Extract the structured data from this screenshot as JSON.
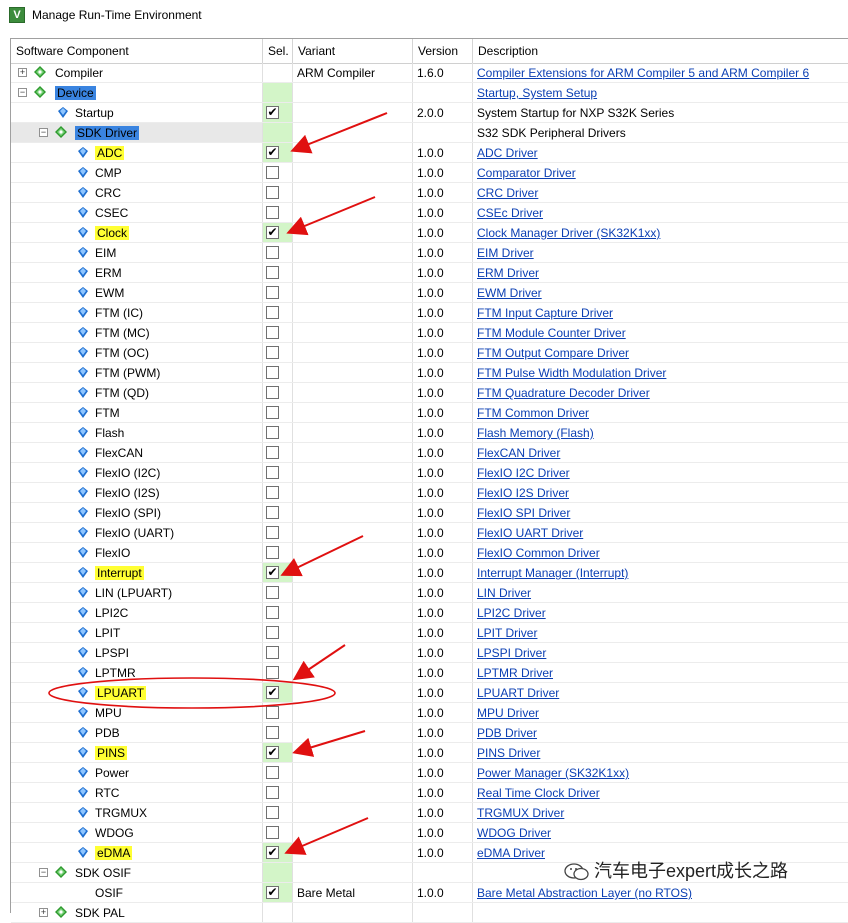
{
  "window": {
    "title": "Manage Run-Time Environment"
  },
  "columns": {
    "component": "Software Component",
    "sel": "Sel.",
    "variant": "Variant",
    "version": "Version",
    "description": "Description"
  },
  "rows": [
    {
      "label": "Compiler",
      "level": 0,
      "expander": "+",
      "icon": "green-gem",
      "selected": false,
      "checkbox": false,
      "green": false,
      "variant": "ARM Compiler",
      "version": "1.6.0",
      "desc": "Compiler Extensions for ARM Compiler 5 and ARM Compiler 6",
      "link": true,
      "hl": ""
    },
    {
      "label": "Device",
      "level": 0,
      "expander": "−",
      "icon": "green-gem",
      "selected": false,
      "checkbox": false,
      "green": true,
      "variant": "",
      "version": "",
      "desc": "Startup, System Setup",
      "link": true,
      "hl": "blue"
    },
    {
      "label": "Startup",
      "level": 1,
      "expander": "",
      "icon": "blue-gem",
      "selected": true,
      "checkbox": true,
      "green": true,
      "variant": "",
      "version": "2.0.0",
      "desc": "System Startup for NXP S32K Series",
      "link": false,
      "hl": ""
    },
    {
      "label": "SDK Driver",
      "level": 1,
      "expander": "−",
      "icon": "green-gem",
      "selected": false,
      "checkbox": false,
      "green": true,
      "variant": "",
      "version": "",
      "desc": "S32 SDK Peripheral Drivers",
      "link": false,
      "hl": "blue",
      "rowsel": true
    },
    {
      "label": "ADC",
      "level": 2,
      "expander": "",
      "icon": "blue-gem",
      "selected": true,
      "checkbox": true,
      "green": true,
      "variant": "",
      "version": "1.0.0",
      "desc": "ADC Driver",
      "link": true,
      "hl": "yellow"
    },
    {
      "label": "CMP",
      "level": 2,
      "expander": "",
      "icon": "blue-gem",
      "selected": false,
      "checkbox": true,
      "green": false,
      "variant": "",
      "version": "1.0.0",
      "desc": "Comparator Driver",
      "link": true,
      "hl": ""
    },
    {
      "label": "CRC",
      "level": 2,
      "expander": "",
      "icon": "blue-gem",
      "selected": false,
      "checkbox": true,
      "green": false,
      "variant": "",
      "version": "1.0.0",
      "desc": "CRC Driver",
      "link": true,
      "hl": ""
    },
    {
      "label": "CSEC",
      "level": 2,
      "expander": "",
      "icon": "blue-gem",
      "selected": false,
      "checkbox": true,
      "green": false,
      "variant": "",
      "version": "1.0.0",
      "desc": "CSEc Driver",
      "link": true,
      "hl": ""
    },
    {
      "label": "Clock",
      "level": 2,
      "expander": "",
      "icon": "blue-gem",
      "selected": true,
      "checkbox": true,
      "green": true,
      "variant": "",
      "version": "1.0.0",
      "desc": "Clock Manager Driver (SK32K1xx)",
      "link": true,
      "hl": "yellow"
    },
    {
      "label": "EIM",
      "level": 2,
      "expander": "",
      "icon": "blue-gem",
      "selected": false,
      "checkbox": true,
      "green": false,
      "variant": "",
      "version": "1.0.0",
      "desc": "EIM Driver",
      "link": true,
      "hl": ""
    },
    {
      "label": "ERM",
      "level": 2,
      "expander": "",
      "icon": "blue-gem",
      "selected": false,
      "checkbox": true,
      "green": false,
      "variant": "",
      "version": "1.0.0",
      "desc": "ERM Driver",
      "link": true,
      "hl": ""
    },
    {
      "label": "EWM",
      "level": 2,
      "expander": "",
      "icon": "blue-gem",
      "selected": false,
      "checkbox": true,
      "green": false,
      "variant": "",
      "version": "1.0.0",
      "desc": "EWM Driver",
      "link": true,
      "hl": ""
    },
    {
      "label": "FTM (IC)",
      "level": 2,
      "expander": "",
      "icon": "blue-gem",
      "selected": false,
      "checkbox": true,
      "green": false,
      "variant": "",
      "version": "1.0.0",
      "desc": "FTM Input Capture Driver",
      "link": true,
      "hl": ""
    },
    {
      "label": "FTM (MC)",
      "level": 2,
      "expander": "",
      "icon": "blue-gem",
      "selected": false,
      "checkbox": true,
      "green": false,
      "variant": "",
      "version": "1.0.0",
      "desc": "FTM Module Counter Driver",
      "link": true,
      "hl": ""
    },
    {
      "label": "FTM (OC)",
      "level": 2,
      "expander": "",
      "icon": "blue-gem",
      "selected": false,
      "checkbox": true,
      "green": false,
      "variant": "",
      "version": "1.0.0",
      "desc": "FTM Output Compare Driver",
      "link": true,
      "hl": ""
    },
    {
      "label": "FTM (PWM)",
      "level": 2,
      "expander": "",
      "icon": "blue-gem",
      "selected": false,
      "checkbox": true,
      "green": false,
      "variant": "",
      "version": "1.0.0",
      "desc": "FTM Pulse Width Modulation Driver",
      "link": true,
      "hl": ""
    },
    {
      "label": "FTM (QD)",
      "level": 2,
      "expander": "",
      "icon": "blue-gem",
      "selected": false,
      "checkbox": true,
      "green": false,
      "variant": "",
      "version": "1.0.0",
      "desc": "FTM Quadrature Decoder Driver",
      "link": true,
      "hl": ""
    },
    {
      "label": "FTM",
      "level": 2,
      "expander": "",
      "icon": "blue-gem",
      "selected": false,
      "checkbox": true,
      "green": false,
      "variant": "",
      "version": "1.0.0",
      "desc": "FTM Common Driver",
      "link": true,
      "hl": ""
    },
    {
      "label": "Flash",
      "level": 2,
      "expander": "",
      "icon": "blue-gem",
      "selected": false,
      "checkbox": true,
      "green": false,
      "variant": "",
      "version": "1.0.0",
      "desc": "Flash Memory (Flash)",
      "link": true,
      "hl": ""
    },
    {
      "label": "FlexCAN",
      "level": 2,
      "expander": "",
      "icon": "blue-gem",
      "selected": false,
      "checkbox": true,
      "green": false,
      "variant": "",
      "version": "1.0.0",
      "desc": "FlexCAN Driver",
      "link": true,
      "hl": ""
    },
    {
      "label": "FlexIO (I2C)",
      "level": 2,
      "expander": "",
      "icon": "blue-gem",
      "selected": false,
      "checkbox": true,
      "green": false,
      "variant": "",
      "version": "1.0.0",
      "desc": "FlexIO I2C Driver",
      "link": true,
      "hl": ""
    },
    {
      "label": "FlexIO (I2S)",
      "level": 2,
      "expander": "",
      "icon": "blue-gem",
      "selected": false,
      "checkbox": true,
      "green": false,
      "variant": "",
      "version": "1.0.0",
      "desc": "FlexIO I2S Driver",
      "link": true,
      "hl": ""
    },
    {
      "label": "FlexIO (SPI)",
      "level": 2,
      "expander": "",
      "icon": "blue-gem",
      "selected": false,
      "checkbox": true,
      "green": false,
      "variant": "",
      "version": "1.0.0",
      "desc": "FlexIO SPI Driver",
      "link": true,
      "hl": ""
    },
    {
      "label": "FlexIO (UART)",
      "level": 2,
      "expander": "",
      "icon": "blue-gem",
      "selected": false,
      "checkbox": true,
      "green": false,
      "variant": "",
      "version": "1.0.0",
      "desc": "FlexIO UART Driver",
      "link": true,
      "hl": ""
    },
    {
      "label": "FlexIO",
      "level": 2,
      "expander": "",
      "icon": "blue-gem",
      "selected": false,
      "checkbox": true,
      "green": false,
      "variant": "",
      "version": "1.0.0",
      "desc": "FlexIO Common Driver",
      "link": true,
      "hl": ""
    },
    {
      "label": "Interrupt",
      "level": 2,
      "expander": "",
      "icon": "blue-gem",
      "selected": true,
      "checkbox": true,
      "green": true,
      "variant": "",
      "version": "1.0.0",
      "desc": "Interrupt Manager (Interrupt)",
      "link": true,
      "hl": "yellow"
    },
    {
      "label": "LIN (LPUART)",
      "level": 2,
      "expander": "",
      "icon": "blue-gem",
      "selected": false,
      "checkbox": true,
      "green": false,
      "variant": "",
      "version": "1.0.0",
      "desc": "LIN Driver",
      "link": true,
      "hl": ""
    },
    {
      "label": "LPI2C",
      "level": 2,
      "expander": "",
      "icon": "blue-gem",
      "selected": false,
      "checkbox": true,
      "green": false,
      "variant": "",
      "version": "1.0.0",
      "desc": "LPI2C Driver",
      "link": true,
      "hl": ""
    },
    {
      "label": "LPIT",
      "level": 2,
      "expander": "",
      "icon": "blue-gem",
      "selected": false,
      "checkbox": true,
      "green": false,
      "variant": "",
      "version": "1.0.0",
      "desc": "LPIT Driver",
      "link": true,
      "hl": ""
    },
    {
      "label": "LPSPI",
      "level": 2,
      "expander": "",
      "icon": "blue-gem",
      "selected": false,
      "checkbox": true,
      "green": false,
      "variant": "",
      "version": "1.0.0",
      "desc": "LPSPI Driver",
      "link": true,
      "hl": ""
    },
    {
      "label": "LPTMR",
      "level": 2,
      "expander": "",
      "icon": "blue-gem",
      "selected": false,
      "checkbox": true,
      "green": false,
      "variant": "",
      "version": "1.0.0",
      "desc": "LPTMR Driver",
      "link": true,
      "hl": ""
    },
    {
      "label": "LPUART",
      "level": 2,
      "expander": "",
      "icon": "blue-gem",
      "selected": true,
      "checkbox": true,
      "green": true,
      "variant": "",
      "version": "1.0.0",
      "desc": "LPUART Driver",
      "link": true,
      "hl": "yellow"
    },
    {
      "label": "MPU",
      "level": 2,
      "expander": "",
      "icon": "blue-gem",
      "selected": false,
      "checkbox": true,
      "green": false,
      "variant": "",
      "version": "1.0.0",
      "desc": "MPU Driver",
      "link": true,
      "hl": ""
    },
    {
      "label": "PDB",
      "level": 2,
      "expander": "",
      "icon": "blue-gem",
      "selected": false,
      "checkbox": true,
      "green": false,
      "variant": "",
      "version": "1.0.0",
      "desc": "PDB Driver",
      "link": true,
      "hl": ""
    },
    {
      "label": "PINS",
      "level": 2,
      "expander": "",
      "icon": "blue-gem",
      "selected": true,
      "checkbox": true,
      "green": true,
      "variant": "",
      "version": "1.0.0",
      "desc": "PINS Driver",
      "link": true,
      "hl": "yellow"
    },
    {
      "label": "Power",
      "level": 2,
      "expander": "",
      "icon": "blue-gem",
      "selected": false,
      "checkbox": true,
      "green": false,
      "variant": "",
      "version": "1.0.0",
      "desc": "Power Manager (SK32K1xx)",
      "link": true,
      "hl": ""
    },
    {
      "label": "RTC",
      "level": 2,
      "expander": "",
      "icon": "blue-gem",
      "selected": false,
      "checkbox": true,
      "green": false,
      "variant": "",
      "version": "1.0.0",
      "desc": "Real Time Clock Driver",
      "link": true,
      "hl": ""
    },
    {
      "label": "TRGMUX",
      "level": 2,
      "expander": "",
      "icon": "blue-gem",
      "selected": false,
      "checkbox": true,
      "green": false,
      "variant": "",
      "version": "1.0.0",
      "desc": "TRGMUX Driver",
      "link": true,
      "hl": ""
    },
    {
      "label": "WDOG",
      "level": 2,
      "expander": "",
      "icon": "blue-gem",
      "selected": false,
      "checkbox": true,
      "green": false,
      "variant": "",
      "version": "1.0.0",
      "desc": "WDOG Driver",
      "link": true,
      "hl": ""
    },
    {
      "label": "eDMA",
      "level": 2,
      "expander": "",
      "icon": "blue-gem",
      "selected": true,
      "checkbox": true,
      "green": true,
      "variant": "",
      "version": "1.0.0",
      "desc": "eDMA Driver",
      "link": true,
      "hl": "yellow"
    },
    {
      "label": "SDK OSIF",
      "level": 1,
      "expander": "−",
      "icon": "green-gem",
      "selected": false,
      "checkbox": false,
      "green": true,
      "variant": "",
      "version": "",
      "desc": "",
      "link": false,
      "hl": ""
    },
    {
      "label": "OSIF",
      "level": 2,
      "expander": "",
      "icon": "none",
      "selected": true,
      "checkbox": true,
      "green": true,
      "variant": "Bare Metal",
      "version": "1.0.0",
      "desc": "Bare Metal Abstraction Layer (no RTOS)",
      "link": true,
      "hl": ""
    },
    {
      "label": "SDK PAL",
      "level": 1,
      "expander": "+",
      "icon": "green-gem",
      "selected": false,
      "checkbox": false,
      "green": false,
      "variant": "",
      "version": "",
      "desc": "",
      "link": false,
      "hl": ""
    }
  ],
  "watermark": {
    "text": "汽车电子expert成长之路"
  },
  "colors": {
    "highlight_yellow": "#ffff33",
    "highlight_blue": "#3a84e0",
    "selected_green": "#d3f5c8",
    "annotation_red": "#e01010"
  }
}
